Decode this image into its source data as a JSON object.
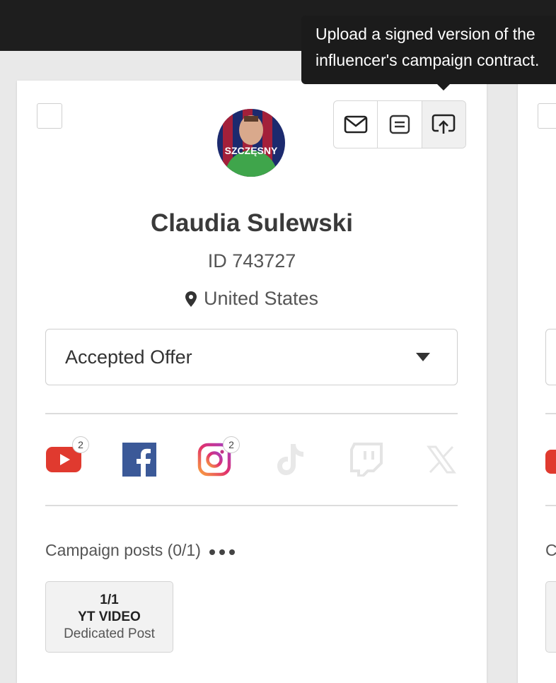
{
  "tooltip": {
    "line1": "Upload a signed version of the",
    "line2": "influencer's campaign contract."
  },
  "card": {
    "actions": [
      {
        "name": "email-button",
        "icon": "envelope-icon"
      },
      {
        "name": "notes-button",
        "icon": "notes-icon"
      },
      {
        "name": "upload-contract-button",
        "icon": "upload-icon"
      }
    ],
    "avatar_text": "SZCZĘSNY",
    "name": "Claudia Sulewski",
    "id_label": "ID 743727",
    "location": "United States",
    "status": {
      "selected": "Accepted Offer"
    },
    "socials": [
      {
        "name": "youtube-icon",
        "badge": "2",
        "active": true,
        "color": "#e03a2f"
      },
      {
        "name": "facebook-icon",
        "badge": "",
        "active": true,
        "color": "#3b5998"
      },
      {
        "name": "instagram-icon",
        "badge": "2",
        "active": true,
        "color": "#d6249f"
      },
      {
        "name": "tiktok-icon",
        "badge": "",
        "active": false,
        "color": "#e6e6e6"
      },
      {
        "name": "twitch-icon",
        "badge": "",
        "active": false,
        "color": "#e6e6e6"
      },
      {
        "name": "x-icon",
        "badge": "",
        "active": false,
        "color": "#e6e6e6"
      }
    ],
    "posts": {
      "title": "Campaign posts (0/1)",
      "items": [
        {
          "count": "1/1",
          "type": "YT VIDEO",
          "kind": "Dedicated Post"
        }
      ]
    }
  },
  "next_card": {
    "posts_title_partial": "C"
  }
}
